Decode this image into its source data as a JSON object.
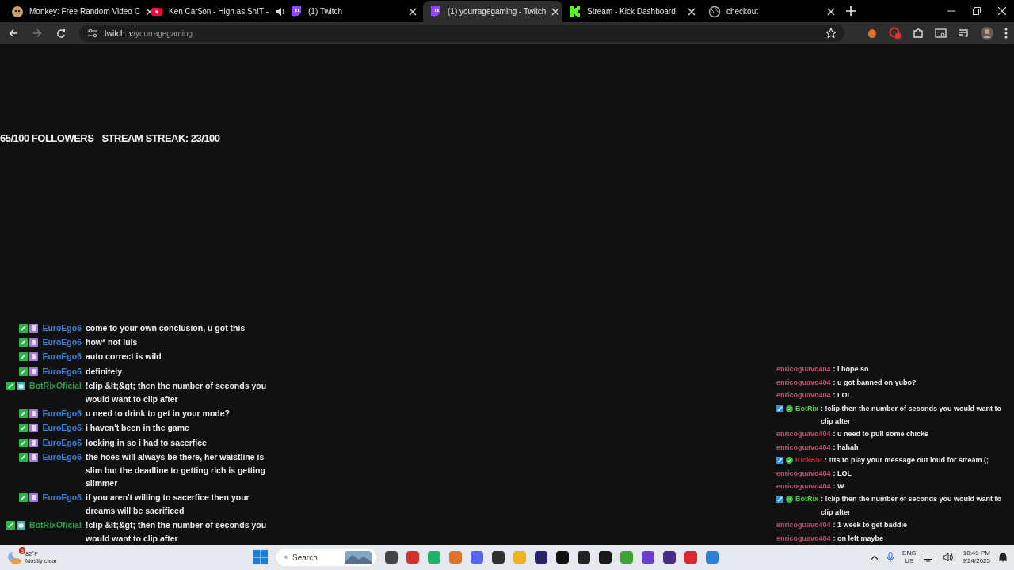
{
  "browser": {
    "tabs": [
      {
        "kind": "monkey",
        "title": "Monkey: Free Random Video C",
        "selected": false,
        "audio": false
      },
      {
        "kind": "youtube",
        "title": "Ken Car$on - High as Sh!T -",
        "selected": false,
        "audio": true
      },
      {
        "kind": "twitch",
        "title": "(1) Twitch",
        "selected": false,
        "audio": false
      },
      {
        "kind": "twitch",
        "title": "(1) yourragegaming - Twitch",
        "selected": true,
        "audio": false
      },
      {
        "kind": "kick",
        "title": "Stream - Kick Dashboard",
        "selected": false,
        "audio": false
      },
      {
        "kind": "globe",
        "title": "checkout",
        "selected": false,
        "audio": false
      }
    ],
    "address": {
      "host": "twitch.tv",
      "path": "/yourragegaming"
    }
  },
  "stream": {
    "goals": [
      "65/100 FOLLOWERS",
      "STREAM STREAK: 23/100"
    ],
    "left_chat": [
      {
        "kind": "user",
        "name": "EuroEgo6",
        "color": "#3f7fd6",
        "text": "come to your own conclusion, u got this"
      },
      {
        "kind": "user",
        "name": "EuroEgo6",
        "color": "#3f7fd6",
        "text": "how* not luis"
      },
      {
        "kind": "user",
        "name": "EuroEgo6",
        "color": "#3f7fd6",
        "text": "auto correct is wild"
      },
      {
        "kind": "user",
        "name": "EuroEgo6",
        "color": "#3f7fd6",
        "text": "definitely"
      },
      {
        "kind": "bot",
        "name": "BotRixOficial",
        "color": "#2e9e4a",
        "text": "!clip &lt;&gt; then the number of seconds you would want to clip after"
      },
      {
        "kind": "user",
        "name": "EuroEgo6",
        "color": "#3f7fd6",
        "text": "u need to drink to get in your mode?"
      },
      {
        "kind": "user",
        "name": "EuroEgo6",
        "color": "#3f7fd6",
        "text": "i haven't been in the game"
      },
      {
        "kind": "user",
        "name": "EuroEgo6",
        "color": "#3f7fd6",
        "text": "locking in so i had to sacerfice"
      },
      {
        "kind": "user",
        "name": "EuroEgo6",
        "color": "#3f7fd6",
        "text": "the hoes will always be there, her waistline is slim but the deadline to getting rich is getting slimmer"
      },
      {
        "kind": "user",
        "name": "EuroEgo6",
        "color": "#3f7fd6",
        "text": "if you aren't willing to sacerfice then your dreams will be sacrificed"
      },
      {
        "kind": "bot",
        "name": "BotRixOficial",
        "color": "#2e9e4a",
        "text": "!clip &lt;&gt; then the number of seconds you would want to clip after"
      }
    ],
    "right_chat": [
      {
        "kind": "user",
        "name": "enricoguavo404",
        "color": "#c0506e",
        "text": ": i hope so"
      },
      {
        "kind": "user",
        "name": "enricoguavo404",
        "color": "#c0506e",
        "text": ": u got banned on yubo?"
      },
      {
        "kind": "user",
        "name": "enricoguavo404",
        "color": "#c0506e",
        "text": ": LOL"
      },
      {
        "kind": "bot",
        "name": "BotRix",
        "color": "#4ed14e",
        "text": ": !clip then the number of seconds you would want to clip after"
      },
      {
        "kind": "user",
        "name": "enricoguavo404",
        "color": "#c0506e",
        "text": ": u need to pull some chicks"
      },
      {
        "kind": "user",
        "name": "enricoguavo404",
        "color": "#c0506e",
        "text": ": hahah"
      },
      {
        "kind": "bot",
        "name": "KickBot",
        "color": "#c0203a",
        "text": ": !tts to play your message out loud for stream (;"
      },
      {
        "kind": "user",
        "name": "enricoguavo404",
        "color": "#c0506e",
        "text": ": LOL"
      },
      {
        "kind": "user",
        "name": "enricoguavo404",
        "color": "#c0506e",
        "text": ": W"
      },
      {
        "kind": "bot",
        "name": "BotRix",
        "color": "#4ed14e",
        "text": ": !clip then the number of seconds you would want to clip after"
      },
      {
        "kind": "user",
        "name": "enricoguavo404",
        "color": "#c0506e",
        "text": ": 1 week to get baddie"
      },
      {
        "kind": "user",
        "name": "enricoguavo404",
        "color": "#c0506e",
        "text": ": on left maybe"
      }
    ]
  },
  "taskbar": {
    "weather": {
      "badge": "3",
      "temperature": "82°F",
      "condition": "Mostly clear"
    },
    "search": {
      "placeholder": "Search"
    },
    "apps": [
      {
        "color": "#444444"
      },
      {
        "color": "#d93025"
      },
      {
        "color": "#1db36b"
      },
      {
        "color": "#e0702a"
      },
      {
        "color": "#5865f2"
      },
      {
        "color": "#303030"
      },
      {
        "color": "#f2b01e"
      },
      {
        "color": "#2a1f6e"
      },
      {
        "color": "#111111"
      },
      {
        "color": "#222222"
      },
      {
        "color": "#181818"
      },
      {
        "color": "#3aa52f"
      },
      {
        "color": "#6a3fd0"
      },
      {
        "color": "#4b2a8a"
      },
      {
        "color": "#e0242f"
      },
      {
        "color": "#2a7fd8"
      }
    ],
    "language": [
      "ENG",
      "US"
    ],
    "time": "10:49 PM",
    "date": "9/24/2025"
  }
}
